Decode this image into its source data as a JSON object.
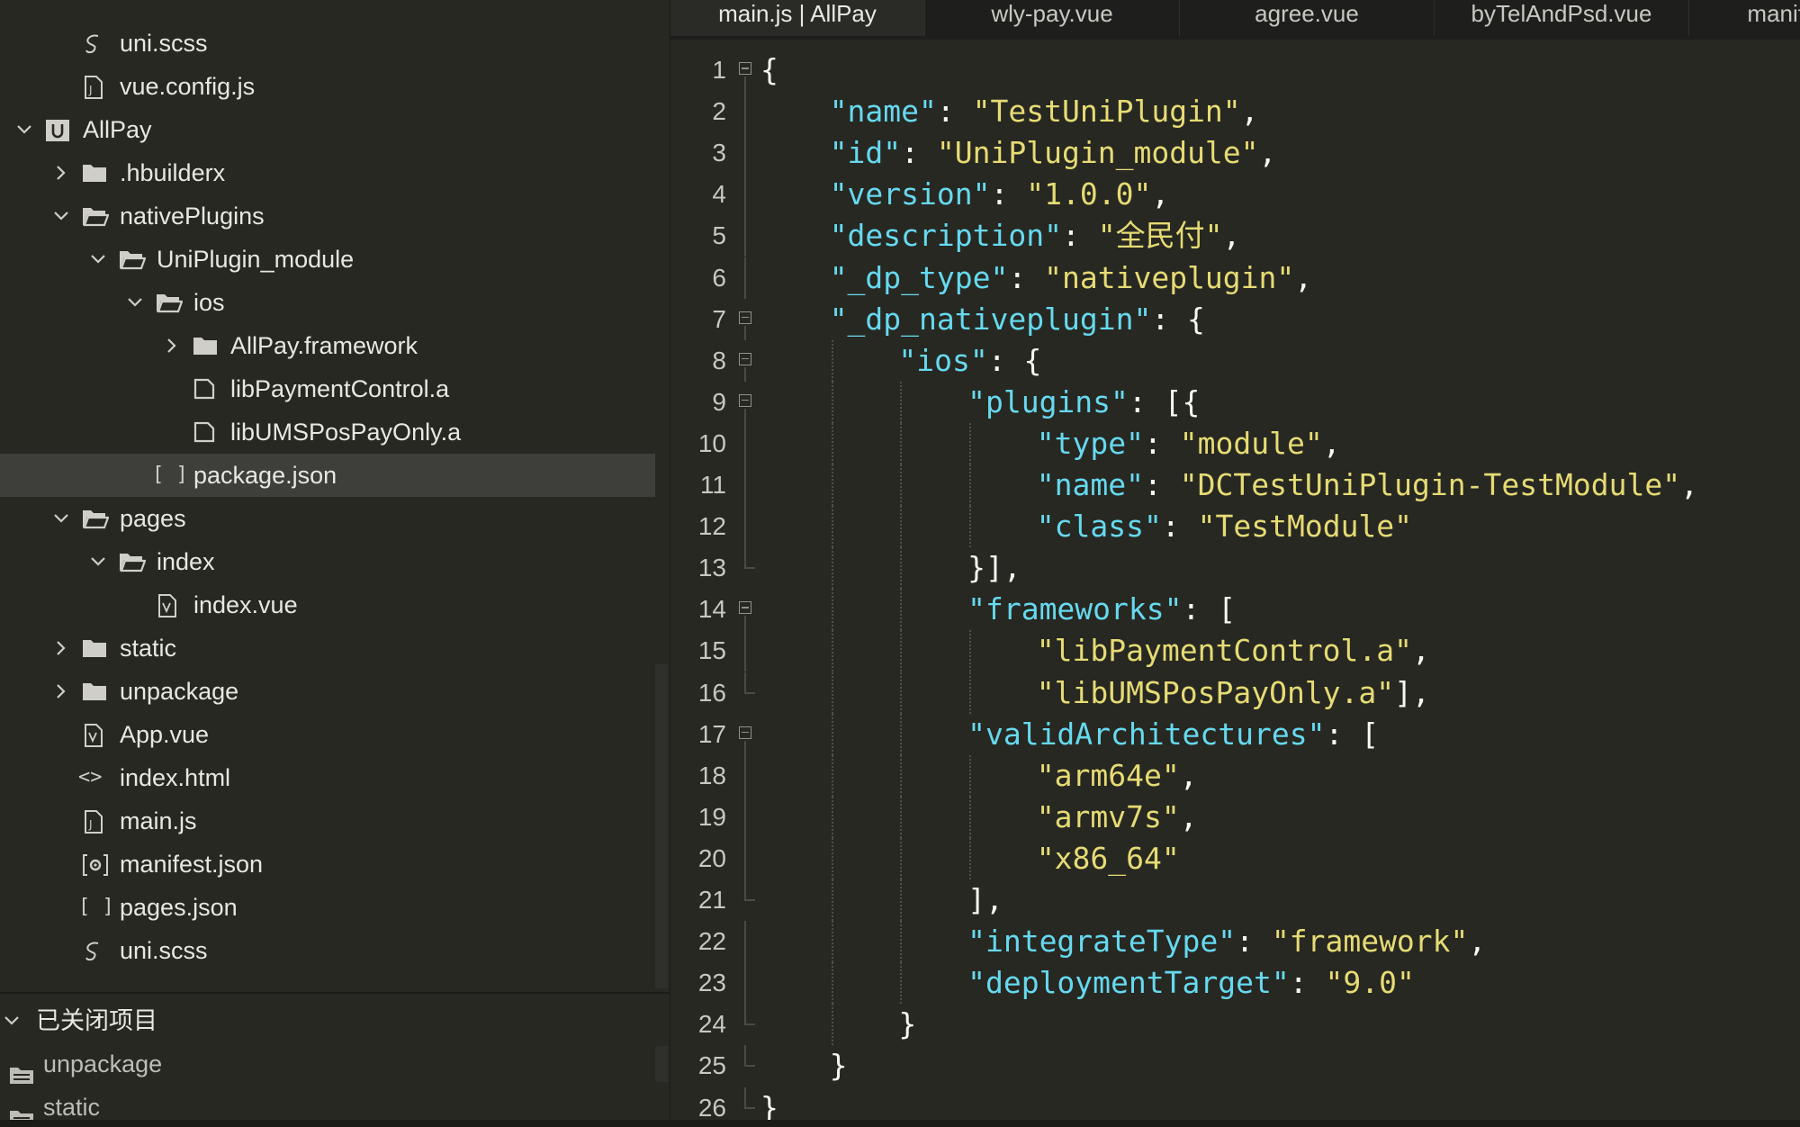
{
  "sidebar": {
    "items": [
      {
        "label": "uni.scss",
        "icon": "sass-file-icon",
        "chevron": "none",
        "depth": 1
      },
      {
        "label": "vue.config.js",
        "icon": "js-file-icon",
        "chevron": "none",
        "depth": 1
      },
      {
        "label": "AllPay",
        "icon": "uniapp-project-icon",
        "chevron": "down",
        "depth": 0
      },
      {
        "label": ".hbuilderx",
        "icon": "folder-icon",
        "chevron": "right",
        "depth": 1
      },
      {
        "label": "nativePlugins",
        "icon": "folder-open-icon",
        "chevron": "down",
        "depth": 1
      },
      {
        "label": "UniPlugin_module",
        "icon": "folder-open-icon",
        "chevron": "down",
        "depth": 2
      },
      {
        "label": "ios",
        "icon": "folder-open-icon",
        "chevron": "down",
        "depth": 3
      },
      {
        "label": "AllPay.framework",
        "icon": "folder-icon",
        "chevron": "right",
        "depth": 4
      },
      {
        "label": "libPaymentControl.a",
        "icon": "file-icon",
        "chevron": "none",
        "depth": 4
      },
      {
        "label": "libUMSPosPayOnly.a",
        "icon": "file-icon",
        "chevron": "none",
        "depth": 4
      },
      {
        "label": "package.json",
        "icon": "json-file-icon",
        "chevron": "none",
        "depth": 3,
        "selected": true
      },
      {
        "label": "pages",
        "icon": "folder-open-icon",
        "chevron": "down",
        "depth": 1
      },
      {
        "label": "index",
        "icon": "folder-open-icon",
        "chevron": "down",
        "depth": 2
      },
      {
        "label": "index.vue",
        "icon": "vue-file-icon",
        "chevron": "none",
        "depth": 3
      },
      {
        "label": "static",
        "icon": "folder-icon",
        "chevron": "right",
        "depth": 1
      },
      {
        "label": "unpackage",
        "icon": "folder-icon",
        "chevron": "right",
        "depth": 1
      },
      {
        "label": "App.vue",
        "icon": "vue-file-icon",
        "chevron": "none",
        "depth": 1
      },
      {
        "label": "index.html",
        "icon": "html-file-icon",
        "chevron": "none",
        "depth": 1
      },
      {
        "label": "main.js",
        "icon": "js-file-icon",
        "chevron": "none",
        "depth": 1
      },
      {
        "label": "manifest.json",
        "icon": "manifest-file-icon",
        "chevron": "none",
        "depth": 1
      },
      {
        "label": "pages.json",
        "icon": "json-file-icon",
        "chevron": "none",
        "depth": 1
      },
      {
        "label": "uni.scss",
        "icon": "sass-file-icon",
        "chevron": "none",
        "depth": 1
      }
    ],
    "closed_projects": {
      "header": "已关闭项目",
      "items": [
        {
          "label": "unpackage",
          "icon": "closed-project-icon"
        },
        {
          "label": "static",
          "icon": "closed-project-icon"
        }
      ]
    }
  },
  "tabs": [
    {
      "label": "main.js | AllPay",
      "active": true
    },
    {
      "label": "wly-pay.vue",
      "active": false
    },
    {
      "label": "agree.vue",
      "active": false
    },
    {
      "label": "byTelAndPsd.vue",
      "active": false
    },
    {
      "label": "manifest.json",
      "active": false
    }
  ],
  "editor": {
    "colors": {
      "key": "#66d9ef",
      "string": "#e6db74",
      "punct": "#f8f8f2",
      "background": "#272822"
    },
    "lines": [
      {
        "n": "1",
        "fold": "open",
        "indent": 0,
        "tokens": [
          [
            "p",
            "{"
          ]
        ]
      },
      {
        "n": "2",
        "fold": "line",
        "indent": 1,
        "tokens": [
          [
            "k",
            "\"name\""
          ],
          [
            "p",
            ": "
          ],
          [
            "s",
            "\"TestUniPlugin\""
          ],
          [
            "p",
            ","
          ]
        ]
      },
      {
        "n": "3",
        "fold": "line",
        "indent": 1,
        "tokens": [
          [
            "k",
            "\"id\""
          ],
          [
            "p",
            ": "
          ],
          [
            "s",
            "\"UniPlugin_module\""
          ],
          [
            "p",
            ","
          ]
        ]
      },
      {
        "n": "4",
        "fold": "line",
        "indent": 1,
        "tokens": [
          [
            "k",
            "\"version\""
          ],
          [
            "p",
            ": "
          ],
          [
            "s",
            "\"1.0.0\""
          ],
          [
            "p",
            ","
          ]
        ]
      },
      {
        "n": "5",
        "fold": "line",
        "indent": 1,
        "tokens": [
          [
            "k",
            "\"description\""
          ],
          [
            "p",
            ": "
          ],
          [
            "s",
            "\"全民付\""
          ],
          [
            "p",
            ","
          ]
        ]
      },
      {
        "n": "6",
        "fold": "line",
        "indent": 1,
        "tokens": [
          [
            "k",
            "\"_dp_type\""
          ],
          [
            "p",
            ": "
          ],
          [
            "s",
            "\"nativeplugin\""
          ],
          [
            "p",
            ","
          ]
        ]
      },
      {
        "n": "7",
        "fold": "open",
        "indent": 1,
        "tokens": [
          [
            "k",
            "\"_dp_nativeplugin\""
          ],
          [
            "p",
            ": {"
          ]
        ]
      },
      {
        "n": "8",
        "fold": "open",
        "indent": 2,
        "tokens": [
          [
            "k",
            "\"ios\""
          ],
          [
            "p",
            ": {"
          ]
        ]
      },
      {
        "n": "9",
        "fold": "open",
        "indent": 3,
        "tokens": [
          [
            "k",
            "\"plugins\""
          ],
          [
            "p",
            ": [{"
          ]
        ]
      },
      {
        "n": "10",
        "fold": "line",
        "indent": 4,
        "tokens": [
          [
            "k",
            "\"type\""
          ],
          [
            "p",
            ": "
          ],
          [
            "s",
            "\"module\""
          ],
          [
            "p",
            ","
          ]
        ]
      },
      {
        "n": "11",
        "fold": "line",
        "indent": 4,
        "tokens": [
          [
            "k",
            "\"name\""
          ],
          [
            "p",
            ": "
          ],
          [
            "s",
            "\"DCTestUniPlugin-TestModule\""
          ],
          [
            "p",
            ","
          ]
        ]
      },
      {
        "n": "12",
        "fold": "line",
        "indent": 4,
        "tokens": [
          [
            "k",
            "\"class\""
          ],
          [
            "p",
            ": "
          ],
          [
            "s",
            "\"TestModule\""
          ]
        ]
      },
      {
        "n": "13",
        "fold": "end",
        "indent": 3,
        "tokens": [
          [
            "p",
            "}],"
          ]
        ]
      },
      {
        "n": "14",
        "fold": "open",
        "indent": 3,
        "tokens": [
          [
            "k",
            "\"frameworks\""
          ],
          [
            "p",
            ": ["
          ]
        ]
      },
      {
        "n": "15",
        "fold": "line",
        "indent": 4,
        "tokens": [
          [
            "s",
            "\"libPaymentControl.a\""
          ],
          [
            "p",
            ","
          ]
        ]
      },
      {
        "n": "16",
        "fold": "end",
        "indent": 4,
        "tokens": [
          [
            "s",
            "\"libUMSPosPayOnly.a\""
          ],
          [
            "p",
            "],"
          ]
        ]
      },
      {
        "n": "17",
        "fold": "open",
        "indent": 3,
        "tokens": [
          [
            "k",
            "\"validArchitectures\""
          ],
          [
            "p",
            ": ["
          ]
        ]
      },
      {
        "n": "18",
        "fold": "line",
        "indent": 4,
        "tokens": [
          [
            "s",
            "\"arm64e\""
          ],
          [
            "p",
            ","
          ]
        ]
      },
      {
        "n": "19",
        "fold": "line",
        "indent": 4,
        "tokens": [
          [
            "s",
            "\"armv7s\""
          ],
          [
            "p",
            ","
          ]
        ]
      },
      {
        "n": "20",
        "fold": "line",
        "indent": 4,
        "tokens": [
          [
            "s",
            "\"x86_64\""
          ]
        ]
      },
      {
        "n": "21",
        "fold": "end",
        "indent": 3,
        "tokens": [
          [
            "p",
            "],"
          ]
        ]
      },
      {
        "n": "22",
        "fold": "line",
        "indent": 3,
        "tokens": [
          [
            "k",
            "\"integrateType\""
          ],
          [
            "p",
            ": "
          ],
          [
            "s",
            "\"framework\""
          ],
          [
            "p",
            ","
          ]
        ]
      },
      {
        "n": "23",
        "fold": "line",
        "indent": 3,
        "tokens": [
          [
            "k",
            "\"deploymentTarget\""
          ],
          [
            "p",
            ": "
          ],
          [
            "s",
            "\"9.0\""
          ]
        ]
      },
      {
        "n": "24",
        "fold": "end",
        "indent": 2,
        "tokens": [
          [
            "p",
            "}"
          ]
        ]
      },
      {
        "n": "25",
        "fold": "end",
        "indent": 1,
        "tokens": [
          [
            "p",
            "}"
          ]
        ]
      },
      {
        "n": "26",
        "fold": "end",
        "indent": 0,
        "tokens": [
          [
            "p",
            "}"
          ]
        ]
      }
    ]
  }
}
